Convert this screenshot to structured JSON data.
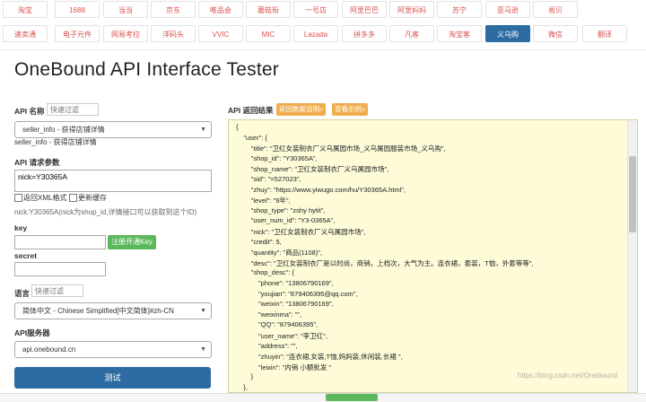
{
  "nav": {
    "row1": [
      "淘宝",
      "1688",
      "当当",
      "京东",
      "唯品会",
      "蘑菇街",
      "一号店",
      "阿里巴巴",
      "阿里妈妈",
      "苏宁",
      "亚马逊",
      "易贝"
    ],
    "row2": [
      "速卖通",
      "电子元件",
      "网易考拉",
      "洋码头",
      "VVIC",
      "MIC",
      "Lazada",
      "拼多多",
      "凡客",
      "淘宝客",
      "义乌购",
      "微信",
      "翻译"
    ],
    "active": "义乌购"
  },
  "page_title": "OneBound API Interface Tester",
  "left": {
    "api_name_label": "API 名称",
    "api_filter_placeholder": "快速过滤",
    "api_select_value": "seller_info - 获得店铺详情",
    "api_desc": "seller_info - 获得店铺详情",
    "params_label": "API 请求参数",
    "params_value": "nick=Y30365A",
    "cb_xml": "返回XML格式",
    "cb_cache": "更新缓存",
    "param_hint": "nick:Y30365A(nick为shop_id,详情接口可以获取到这个ID)",
    "key_label": "key",
    "register_button": "注册开通Key",
    "secret_label": "secret",
    "lang_label": "语言",
    "lang_filter_placeholder": "快速过滤",
    "lang_select_value": "简体中文 - Chinese Simplified[中文简体]#zh-CN",
    "server_label": "API服务器",
    "server_value": "api.onebound.cn",
    "test_button": "测试"
  },
  "result": {
    "label": "API 返回结果",
    "btn_doc": "返回数据说明»",
    "btn_example": "查看示例»",
    "lines": [
      "{",
      "    \"user\": {",
      "        \"title\": \"卫红女装制衣厂义乌属园市场_义乌属园服装市场_义乌购\",",
      "        \"shop_id\": \"Y30365A\",",
      "        \"shop_name\": \"卫红女装制衣厂义乌属园市场\",",
      "        \"sid\": \"=527023\",",
      "        \"zhuy\": \"https://www.yiwugo.com/hu/Y30365A.html\",",
      "        \"level\": \"9年\",",
      "        \"shop_type\": \"zshy hytit\",",
      "        \"user_num_id\": \"Y3-0365A\",",
      "        \"nick\": \"卫红女装制衣厂义乌属园市场\",",
      "        \"credit\": 5,",
      "        \"quantity\": \"商品(1108)\",",
      "        \"desc\": \"卫红女装制衣厂是以时尚，商销，上档次，大气为主。连衣裙，套装，T恤，外套等等\",",
      "        \"shop_desc\": {",
      "            \"phone\": \"13806790169\",",
      "            \"youjian\": \"879406395@qq.com\",",
      "            \"weixin\": \"13806790169\",",
      "            \"weixinma\": \"\",",
      "            \"QQ\": \"879406395\",",
      "            \"user_name\": \"李卫红\",",
      "            \"address\": \"\",",
      "            \"zhuyin\": \"连衣裙,女装,T恤,妈妈装,休闲装,长裙 \",",
      "            \"leixin\": \"内销 小额批发 \"",
      "        }",
      "    },"
    ],
    "watermark": "https://blog.csdn.net/Onebound"
  }
}
